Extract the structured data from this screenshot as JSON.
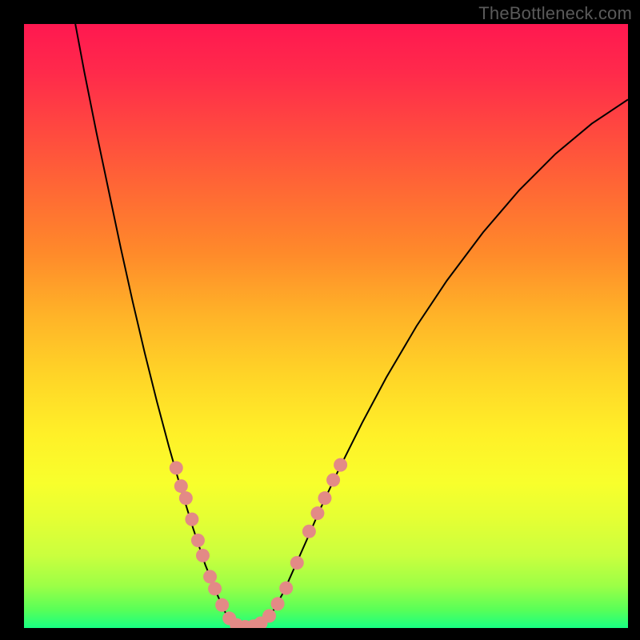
{
  "watermark": "TheBottleneck.com",
  "colors": {
    "curve_stroke": "#000000",
    "marker_fill": "#e38a86",
    "marker_stroke": "#c97470"
  },
  "chart_data": {
    "type": "line",
    "title": "",
    "xlabel": "",
    "ylabel": "",
    "xlim": [
      0,
      100
    ],
    "ylim": [
      0,
      100
    ],
    "curve": {
      "comment": "V-shaped bottleneck curve; y = percent (100 top, 0 bottom), x = percent across plot area",
      "points": [
        {
          "x": 8.5,
          "y": 100.0
        },
        {
          "x": 10.0,
          "y": 92.0
        },
        {
          "x": 12.0,
          "y": 82.0
        },
        {
          "x": 14.0,
          "y": 72.5
        },
        {
          "x": 16.0,
          "y": 63.0
        },
        {
          "x": 18.0,
          "y": 54.0
        },
        {
          "x": 20.0,
          "y": 45.5
        },
        {
          "x": 22.0,
          "y": 37.5
        },
        {
          "x": 24.0,
          "y": 30.0
        },
        {
          "x": 26.0,
          "y": 23.0
        },
        {
          "x": 28.0,
          "y": 16.5
        },
        {
          "x": 30.0,
          "y": 10.5
        },
        {
          "x": 32.0,
          "y": 5.5
        },
        {
          "x": 33.5,
          "y": 2.2
        },
        {
          "x": 35.0,
          "y": 0.6
        },
        {
          "x": 36.5,
          "y": 0.2
        },
        {
          "x": 38.0,
          "y": 0.2
        },
        {
          "x": 39.5,
          "y": 0.8
        },
        {
          "x": 41.0,
          "y": 2.4
        },
        {
          "x": 43.0,
          "y": 6.0
        },
        {
          "x": 45.0,
          "y": 10.5
        },
        {
          "x": 47.0,
          "y": 15.0
        },
        {
          "x": 49.0,
          "y": 19.6
        },
        {
          "x": 52.0,
          "y": 26.0
        },
        {
          "x": 56.0,
          "y": 34.0
        },
        {
          "x": 60.0,
          "y": 41.5
        },
        {
          "x": 65.0,
          "y": 50.0
        },
        {
          "x": 70.0,
          "y": 57.5
        },
        {
          "x": 76.0,
          "y": 65.5
        },
        {
          "x": 82.0,
          "y": 72.5
        },
        {
          "x": 88.0,
          "y": 78.5
        },
        {
          "x": 94.0,
          "y": 83.5
        },
        {
          "x": 100.0,
          "y": 87.5
        }
      ]
    },
    "series": [
      {
        "name": "markers",
        "comment": "Salmon dots overlaid on curve near the vertex; same coordinate convention as curve",
        "values": [
          {
            "x": 25.2,
            "y": 26.5
          },
          {
            "x": 26.0,
            "y": 23.5
          },
          {
            "x": 26.8,
            "y": 21.5
          },
          {
            "x": 27.8,
            "y": 18.0
          },
          {
            "x": 28.8,
            "y": 14.5
          },
          {
            "x": 29.6,
            "y": 12.0
          },
          {
            "x": 30.8,
            "y": 8.5
          },
          {
            "x": 31.6,
            "y": 6.5
          },
          {
            "x": 32.8,
            "y": 3.8
          },
          {
            "x": 34.0,
            "y": 1.6
          },
          {
            "x": 35.2,
            "y": 0.5
          },
          {
            "x": 36.6,
            "y": 0.2
          },
          {
            "x": 38.0,
            "y": 0.3
          },
          {
            "x": 39.2,
            "y": 0.8
          },
          {
            "x": 40.6,
            "y": 2.0
          },
          {
            "x": 42.0,
            "y": 4.0
          },
          {
            "x": 43.4,
            "y": 6.6
          },
          {
            "x": 45.2,
            "y": 10.8
          },
          {
            "x": 47.2,
            "y": 16.0
          },
          {
            "x": 48.6,
            "y": 19.0
          },
          {
            "x": 49.8,
            "y": 21.5
          },
          {
            "x": 51.2,
            "y": 24.5
          },
          {
            "x": 52.4,
            "y": 27.0
          }
        ]
      }
    ]
  }
}
